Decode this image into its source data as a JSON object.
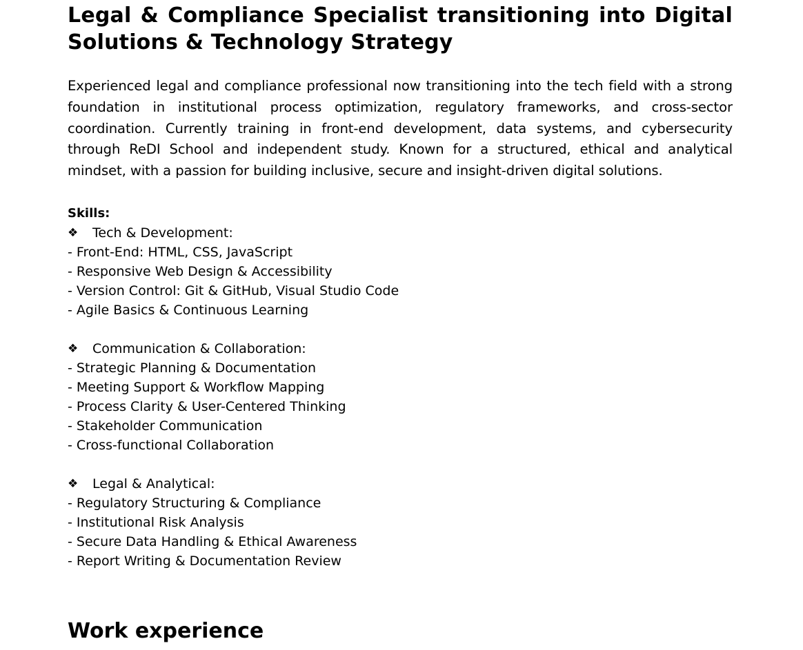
{
  "headline": "Legal & Compliance Specialist transitioning into Digital Solutions & Technology Strategy",
  "summary": "Experienced legal and compliance professional now transitioning into the tech field with a strong foundation in institutional process optimization, regulatory frameworks, and cross-sector coordination. Currently training in front-end development, data systems, and cybersecurity through ReDI School and independent study. Known for a structured, ethical and analytical mindset, with a passion for building inclusive, secure and insight-driven digital solutions.",
  "skills": {
    "title": "Skills:",
    "bullet_icon": "four-diamond-bullet-icon",
    "bullet_glyph": "❖",
    "groups": [
      {
        "heading": "Tech & Development:",
        "items": [
          "- Front-End: HTML, CSS, JavaScript",
          "- Responsive Web Design & Accessibility",
          "- Version Control: Git & GitHub, Visual Studio Code",
          "- Agile Basics & Continuous Learning"
        ]
      },
      {
        "heading": "Communication & Collaboration:",
        "items": [
          "- Strategic Planning & Documentation",
          "- Meeting Support & Workflow Mapping",
          "- Process Clarity & User-Centered Thinking",
          "- Stakeholder Communication",
          "- Cross-functional Collaboration"
        ]
      },
      {
        "heading": "Legal & Analytical:",
        "items": [
          "- Regulatory Structuring & Compliance",
          "- Institutional Risk Analysis",
          "- Secure Data Handling & Ethical Awareness",
          "- Report Writing & Documentation Review"
        ]
      }
    ]
  },
  "work_experience_title": "Work experience"
}
